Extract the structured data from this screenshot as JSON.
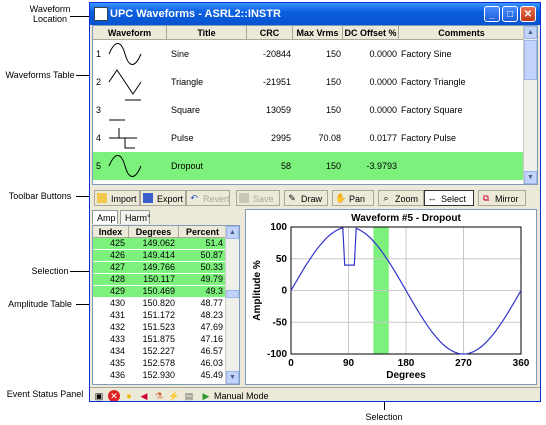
{
  "callouts": {
    "waveform_location": "Waveform\nLocation",
    "waveforms_table": "Waveforms Table",
    "toolbar_buttons": "Toolbar Buttons",
    "selection": "Selection",
    "amplitude_table": "Amplitude Table",
    "event_status_panel": "Event Status Panel",
    "selection_bottom": "Selection"
  },
  "window": {
    "title": "UPC Waveforms - ASRL2::INSTR"
  },
  "waveforms": {
    "columns": [
      "Waveform",
      "Title",
      "CRC",
      "Max Vrms",
      "DC Offset %",
      "Comments"
    ],
    "rows": [
      {
        "index": "1",
        "title": "Sine",
        "crc": "-20844",
        "max_vrms": "150",
        "dc_offset": "0.0000",
        "comments": "Factory Sine",
        "icon": "sine-wave-icon"
      },
      {
        "index": "2",
        "title": "Triangle",
        "crc": "-21951",
        "max_vrms": "150",
        "dc_offset": "0.0000",
        "comments": "Factory Triangle",
        "icon": "triangle-wave-icon"
      },
      {
        "index": "3",
        "title": "Square",
        "crc": "13059",
        "max_vrms": "150",
        "dc_offset": "0.0000",
        "comments": "Factory Square",
        "icon": "square-wave-icon"
      },
      {
        "index": "4",
        "title": "Pulse",
        "crc": "2995",
        "max_vrms": "70.08",
        "dc_offset": "0.0177",
        "comments": "Factory Pulse",
        "icon": "pulse-wave-icon"
      },
      {
        "index": "5",
        "title": "Dropout",
        "crc": "58",
        "max_vrms": "150",
        "dc_offset": "-3.9793",
        "comments": "",
        "icon": "dropout-wave-icon"
      }
    ]
  },
  "toolbar": {
    "import": "Import",
    "export": "Export",
    "revert": "Revert",
    "save": "Save",
    "draw": "Draw",
    "pan": "Pan",
    "zoom": "Zoom",
    "select": "Select",
    "mirror": "Mirror"
  },
  "tabs": {
    "amp": "Amp",
    "harm": "Harm°"
  },
  "amplitude": {
    "columns": [
      "Index",
      "Degrees",
      "Percent"
    ],
    "rows": [
      {
        "index": "425",
        "degrees": "149.062",
        "percent": "51.4",
        "selected": true
      },
      {
        "index": "426",
        "degrees": "149.414",
        "percent": "50.87",
        "selected": true
      },
      {
        "index": "427",
        "degrees": "149.766",
        "percent": "50.33",
        "selected": true
      },
      {
        "index": "428",
        "degrees": "150.117",
        "percent": "49.79",
        "selected": true
      },
      {
        "index": "429",
        "degrees": "150.469",
        "percent": "49.3",
        "selected": true
      },
      {
        "index": "430",
        "degrees": "150.820",
        "percent": "48.77",
        "selected": false
      },
      {
        "index": "431",
        "degrees": "151.172",
        "percent": "48.23",
        "selected": false
      },
      {
        "index": "432",
        "degrees": "151.523",
        "percent": "47.69",
        "selected": false
      },
      {
        "index": "433",
        "degrees": "151.875",
        "percent": "47.16",
        "selected": false
      },
      {
        "index": "434",
        "degrees": "152.227",
        "percent": "46.57",
        "selected": false
      },
      {
        "index": "435",
        "degrees": "152.578",
        "percent": "46.03",
        "selected": false
      },
      {
        "index": "436",
        "degrees": "152.930",
        "percent": "45.49",
        "selected": false
      }
    ]
  },
  "chart_data": {
    "type": "line",
    "title": "Waveform #5 - Dropout",
    "xlabel": "Degrees",
    "ylabel": "Amplitude %",
    "xlim": [
      0,
      360
    ],
    "ylim": [
      -100,
      100
    ],
    "xticks": [
      "0",
      "90",
      "180",
      "270",
      "360"
    ],
    "yticks": [
      "100",
      "50",
      "0",
      "-50",
      "-100"
    ],
    "grid": true,
    "selection_range": [
      129,
      153
    ],
    "dropout_range": [
      82,
      100
    ],
    "dropout_level": 40,
    "color": "#3333cc",
    "selection_color": "#7cf27c"
  },
  "status": {
    "mode": "Manual Mode"
  }
}
